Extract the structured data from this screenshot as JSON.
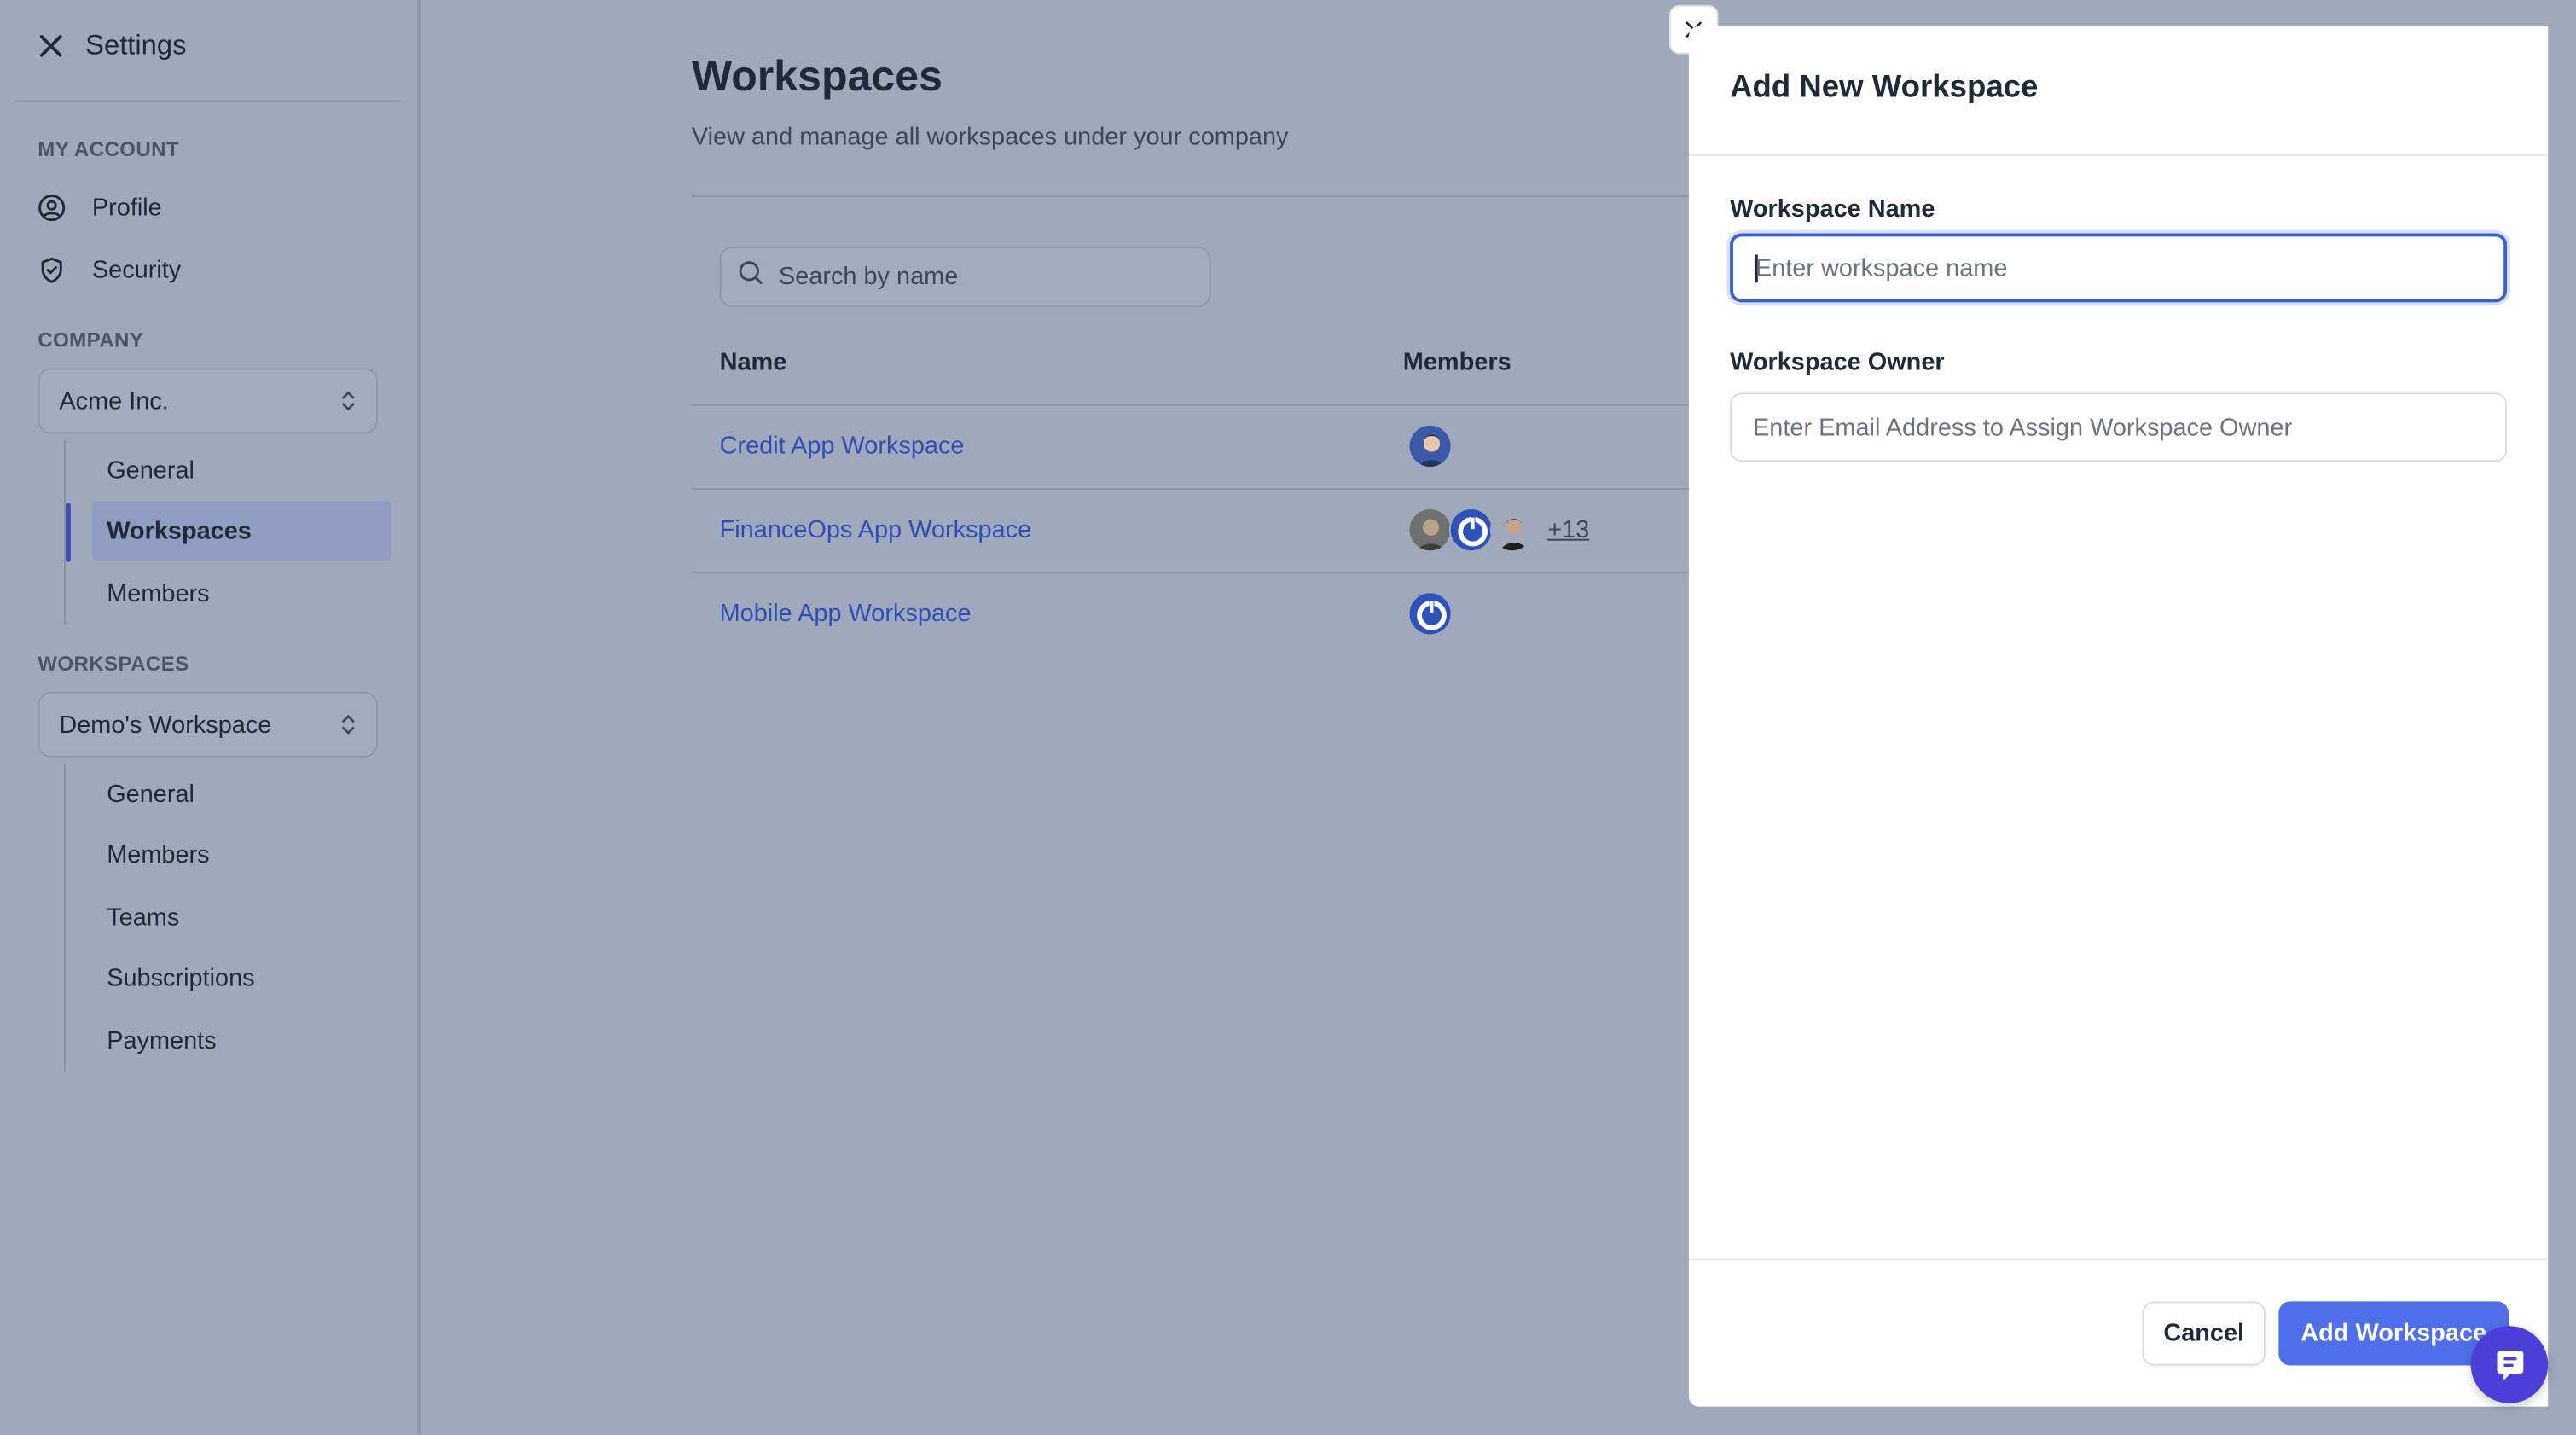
{
  "sidebar": {
    "title": "Settings",
    "my_account": {
      "label": "MY ACCOUNT",
      "items": [
        {
          "label": "Profile",
          "icon": "user-circle-icon"
        },
        {
          "label": "Security",
          "icon": "shield-icon"
        }
      ]
    },
    "company": {
      "label": "COMPANY",
      "selected": "Acme Inc.",
      "items": [
        {
          "label": "General"
        },
        {
          "label": "Workspaces",
          "active": true
        },
        {
          "label": "Members"
        }
      ]
    },
    "workspaces": {
      "label": "WORKSPACES",
      "selected": "Demo's Workspace",
      "items": [
        {
          "label": "General"
        },
        {
          "label": "Members"
        },
        {
          "label": "Teams"
        },
        {
          "label": "Subscriptions"
        },
        {
          "label": "Payments"
        }
      ]
    }
  },
  "main": {
    "title": "Workspaces",
    "subtitle": "View and manage all workspaces under your company",
    "search_placeholder": "Search by name",
    "columns": [
      "Name",
      "Members"
    ],
    "rows": [
      {
        "name": "Credit App Workspace"
      },
      {
        "name": "FinanceOps App Workspace",
        "extra_members": "+13"
      },
      {
        "name": "Mobile App Workspace"
      }
    ]
  },
  "drawer": {
    "title": "Add New Workspace",
    "name_label": "Workspace Name",
    "name_placeholder": "Enter workspace name",
    "owner_label": "Workspace Owner",
    "owner_placeholder": "Enter Email Address to Assign Workspace Owner",
    "cancel_label": "Cancel",
    "submit_label": "Add Workspace"
  },
  "colors": {
    "overlay": "#a0a8bb",
    "link": "#2d4fb5",
    "primary": "#4f6fe8",
    "chat": "#4c3fd8"
  }
}
